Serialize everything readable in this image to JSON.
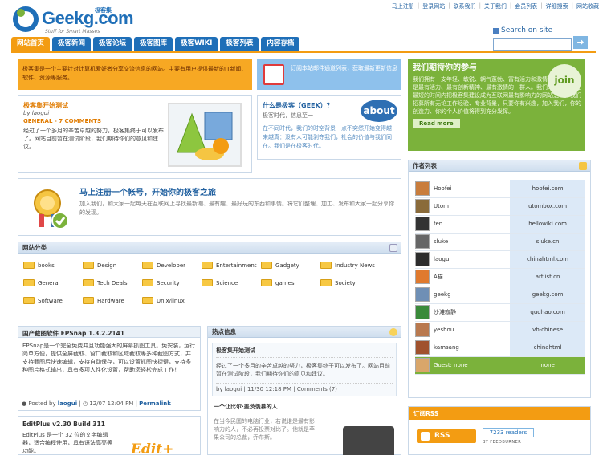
{
  "site": {
    "logo_text": "Geekg.com",
    "logo_cn": "极客集",
    "slogan": "Stuff for Smart Masses",
    "colors": {
      "brand": "#1f6fb8",
      "accent": "#f39c12",
      "green": "#7bb23b"
    }
  },
  "top_links": [
    "马上注册",
    "登录网站",
    "联系我们",
    "关于我们",
    "会员列表",
    "详细搜索",
    "网站收藏"
  ],
  "search": {
    "label": "Search on site",
    "placeholder": "",
    "go_icon": "arrow-right-icon"
  },
  "nav": [
    "网站首页",
    "极客新闻",
    "极客论坛",
    "极客图库",
    "极客WIKI",
    "极客列表",
    "内容存档"
  ],
  "intro": {
    "text": "极客集是一个主要针对计算机爱好者分享交流信息的网站。主要有用户提供最新的IT新闻、软件、资源等服务。"
  },
  "subscribe": {
    "text": "订阅本站邮件通道列表，获取最新更新信息"
  },
  "join": {
    "title": "我们期待你的参与",
    "badge": "join",
    "text": "我们拥有一支年轻、敏锐、朝气蓬勃、富有活力和激情的团队，我们是最有活力、最有创新精神、最有激情的一群人。我们的目标是：在最短的时间内把极客集建设成为互联网最有影响力的网站之一。我们招募所有无论工作经验、专业背景，只要你有兴趣，加入我们，你的创造力、你的个人价值将得到充分发挥。",
    "more": "Read more"
  },
  "post1": {
    "title": "极客集开始测试",
    "by": "by laogui",
    "meta": "GENERAL - 7 COMMENTS",
    "body": "经过了一个多月的辛苦卓越的努力，极客集终于可以发布了。网站目前暂在测试阶段，我们期待你们的意见和建议。"
  },
  "about": {
    "title": "什么是极客（GEEK）？",
    "sub": "极客时代，信息至一",
    "body": "在不同时代，我们的时空背景一点不突然开始变得越来越真：没有人可能剥夺我们，社会的价值与我们同在。我们是在极客时代。",
    "badge": "about"
  },
  "register": {
    "title": "马上注册一个帐号，开始你的极客之旅",
    "body": "加入我们，和大家一起每天在互联网上寻找最新潮、最有趣、最好玩的东西和事情。将它们整理、加工、发布和大家一起分享你的发现。"
  },
  "categories": {
    "title": "网站分类",
    "items": [
      "books",
      "Design",
      "Developer",
      "Entertainment",
      "Gadgety",
      "Industry News",
      "General",
      "Tech Deals",
      "Security",
      "Science",
      "games",
      "Society",
      "Software",
      "Hardware",
      "Unix/linux"
    ]
  },
  "news1": {
    "title": "国产截图软件 EPSnap 1.3.2.2141",
    "body": "EPSnap是一个完全免费并且功能强大的屏幕抓图工具。免安装，运行简单方便，提供全屏截取、窗口截取和区域截取等多种截图方式，并支持截图后快速编辑，支持自动保存，可以设置抓图快捷键，支持多种图片格式输出，具有多项人性化设置，帮助您轻松完成工作！",
    "posted_by": "Posted by",
    "author": "laogui",
    "date": "12/07 12:04 PM",
    "permalink": "Permalink"
  },
  "news2": {
    "title": "EditPlus v2.30 Build 311",
    "body": "EditPlus 是一个 32 位的文字编辑器，适合编程使用，具有语法高亮等功能。",
    "logo": "Edit+"
  },
  "hot": {
    "title": "热点信息",
    "item1": {
      "title": "极客集开始测试",
      "body": "经过了一个多月的辛苦卓越的努力，极客集终于可以发布了。网站目前暂在测试阶段，我们期待你们的意见和建议。",
      "footer": "by laogui | 11/30 12:18 PM | Comments (7)"
    },
    "item2": {
      "title": "一个让比尔·盖茨羡慕的人",
      "body": "在当今民国的电脑行业，若说谁是最有影响力的人，不必再投票对比了。他就是苹果公司的总裁，乔布斯。"
    }
  },
  "authors": {
    "title": "作者列表",
    "rows": [
      {
        "name": "Hoofei",
        "url": "hoofei.com"
      },
      {
        "name": "Utom",
        "url": "utombox.com"
      },
      {
        "name": "fen",
        "url": "hellowiki.com"
      },
      {
        "name": "sluke",
        "url": "sluke.cn"
      },
      {
        "name": "laogui",
        "url": "chinahtml.com"
      },
      {
        "name": "A猫",
        "url": "artlist.cn"
      },
      {
        "name": "geekg",
        "url": "geekg.com"
      },
      {
        "name": "沙滩寂静",
        "url": "qudhao.com"
      },
      {
        "name": "yeshou",
        "url": "vb-chinese"
      },
      {
        "name": "kamsang",
        "url": "chinahtml"
      },
      {
        "name": "Guest: none",
        "url": "none"
      }
    ]
  },
  "rss": {
    "title": "订阅RSS",
    "button": "RSS",
    "readers": "7233 readers",
    "feedburner": "BY FEEDBURNER"
  }
}
